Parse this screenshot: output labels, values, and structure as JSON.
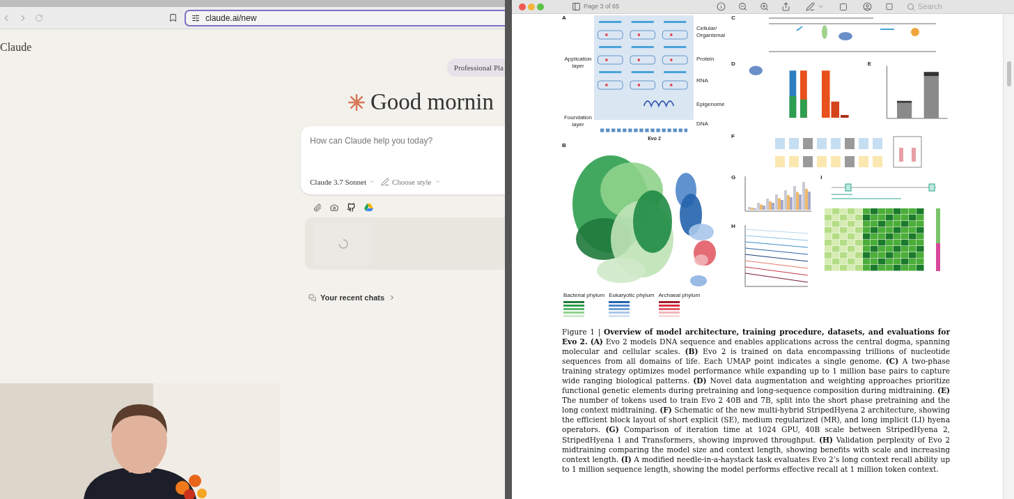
{
  "browser": {
    "url": "claude.ai/new",
    "heading": "Claude",
    "plan_badge": "Professional Pla",
    "greeting": "Good mornin",
    "prompt": {
      "placeholder": "How can Claude help you today?"
    },
    "model": "Claude 3.7 Sonnet",
    "style": "Choose style",
    "recent_chats": "Your recent chats"
  },
  "pdf_viewer": {
    "page_indicator": "Page 3 of 65",
    "search": {
      "placeholder": "Search"
    },
    "figure": {
      "panel_a": {
        "letter": "A",
        "application_layer": "Application layer",
        "foundation_layer": "Foundation layer",
        "model": "Evo 2",
        "layers": [
          "Cellular/ Organismal",
          "Protein",
          "RNA",
          "Epigenome",
          "DNA"
        ]
      },
      "panel_b": {
        "letter": "B",
        "legend": [
          "Bacterial phylum",
          "Eukaryotic phylum",
          "Archaeal phylum"
        ]
      },
      "letters": [
        "C",
        "D",
        "E",
        "F",
        "G",
        "H",
        "I"
      ]
    },
    "caption": "Figure 1 | **Overview of model architecture, training procedure, datasets, and evaluations for Evo 2.** **(A)** Evo 2 models DNA sequence and enables applications across the central dogma, spanning molecular and cellular scales. **(B)** Evo 2 is trained on data encompassing trillions of nucleotide sequences from all domains of life. Each UMAP point indicates a single genome. **(C)** A two-phase training strategy optimizes model performance while expanding up to 1 million base pairs to capture wide ranging biological patterns. **(D)** Novel data augmentation and weighting approaches prioritize functional genetic elements during pretraining and long-sequence composition during midtraining. **(E)** The number of tokens used to train Evo 2 40B and 7B, split into the short phase pretraining and the long context midtraining. **(F)** Schematic of the new multi-hybrid StripedHyena 2 architecture, showing the efficient block layout of short explicit (SE), medium regularized (MR), and long implicit (LI) hyena operators. **(G)** Comparison of iteration time at 1024 GPU, 40B scale between StripedHyena 2, StripedHyena 1 and Transformers, showing improved throughput. **(H)** Validation perplexity of Evo 2 midtraining comparing the model size and context length, showing benefits with scale and increasing context length. **(I)** A modified needle-in-a-haystack task evaluates Evo 2’s long context recall ability up to 1 million sequence length, showing the model performs effective recall at 1 million token context."
  }
}
